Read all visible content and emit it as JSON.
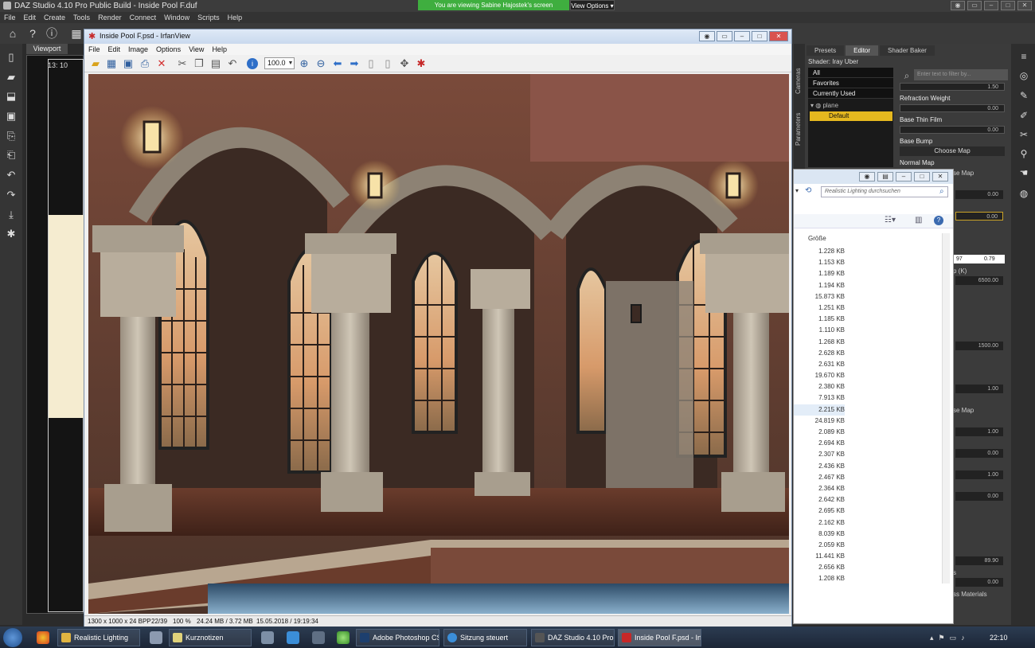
{
  "daz": {
    "title": "DAZ Studio 4.10 Pro Public Build - Inside Pool F.duf",
    "menu": [
      "File",
      "Edit",
      "Create",
      "Tools",
      "Render",
      "Connect",
      "Window",
      "Scripts",
      "Help"
    ],
    "viewport_tab": "Viewport",
    "viewport_time": "13: 10",
    "panel_tabs": [
      "Presets",
      "Editor",
      "Shader Baker"
    ],
    "vertical_tabs": [
      "Cameras",
      "Parameters"
    ],
    "shader_label": "Shader: Iray Uber",
    "material_filters": [
      "All",
      "Favorites",
      "Currently Used"
    ],
    "material_plane": "plane",
    "material_default": "Default",
    "filter_placeholder": "Enter text to filter by...",
    "properties": {
      "refraction_weight": "Refraction Weight",
      "base_thin_film": "Base Thin Film",
      "base_bump": "Base Bump",
      "choose_map": "Choose Map",
      "normal_map": "Normal Map"
    },
    "hints": {
      "se_map_1": "se Map",
      "k_label": "p (K)",
      "se_map_2": "se Map",
      "s_label": "s",
      "ss_materials": "ss Materials"
    },
    "values": {
      "v1": "1.50",
      "v2": "0.00",
      "v3": "0.00",
      "v4": "0.00",
      "v5": "0.00",
      "val_left": "97",
      "val_right": "0.79",
      "v6": "6500.00",
      "v7": "1500.00",
      "v8": "1.00",
      "v9": "1.00",
      "v10": "0.00",
      "v11": "1.00",
      "v12": "0.00",
      "v13": "89.90",
      "v14": "0.00"
    }
  },
  "share_banner": "You are viewing Sabine Hajostek's screen",
  "view_options": "View Options",
  "explorer": {
    "search_placeholder": "Realistic Lighting durchsuchen",
    "column_header": "Größe",
    "sizes": [
      "1.228 KB",
      "1.153 KB",
      "1.189 KB",
      "1.194 KB",
      "15.873 KB",
      "1.251 KB",
      "1.185 KB",
      "1.110 KB",
      "1.268 KB",
      "2.628 KB",
      "2.631 KB",
      "19.670 KB",
      "2.380 KB",
      "7.913 KB",
      "2.215 KB",
      "24.819 KB",
      "2.089 KB",
      "2.694 KB",
      "2.307 KB",
      "2.436 KB",
      "2.467 KB",
      "2.364 KB",
      "2.642 KB",
      "2.695 KB",
      "2.162 KB",
      "8.039 KB",
      "2.059 KB",
      "11.441 KB",
      "2.656 KB",
      "1.208 KB"
    ],
    "selected_index": 14
  },
  "irfanview": {
    "title": "Inside Pool F.psd - IrfanView",
    "menu": [
      "File",
      "Edit",
      "Image",
      "Options",
      "View",
      "Help"
    ],
    "zoom": "100.0",
    "status": {
      "dimensions": "1300 x 1000 x 24 BPP",
      "index": "22/39",
      "zoom": "100 %",
      "memory": "24.24 MB / 3.72 MB",
      "date": "15.05.2018 / 19:19:34"
    }
  },
  "taskbar": {
    "tasks": [
      "Realistic Lighting",
      "Kurznotizen",
      "Adobe Photoshop CS6",
      "Sitzung steuert",
      "DAZ Studio 4.10 Pro ...",
      "Inside Pool F.psd - Irf..."
    ],
    "clock": "22:10"
  },
  "colors": {
    "accent_yellow": "#e5b81f",
    "banner_green": "#3fae3f",
    "close_red": "#d9534f"
  }
}
